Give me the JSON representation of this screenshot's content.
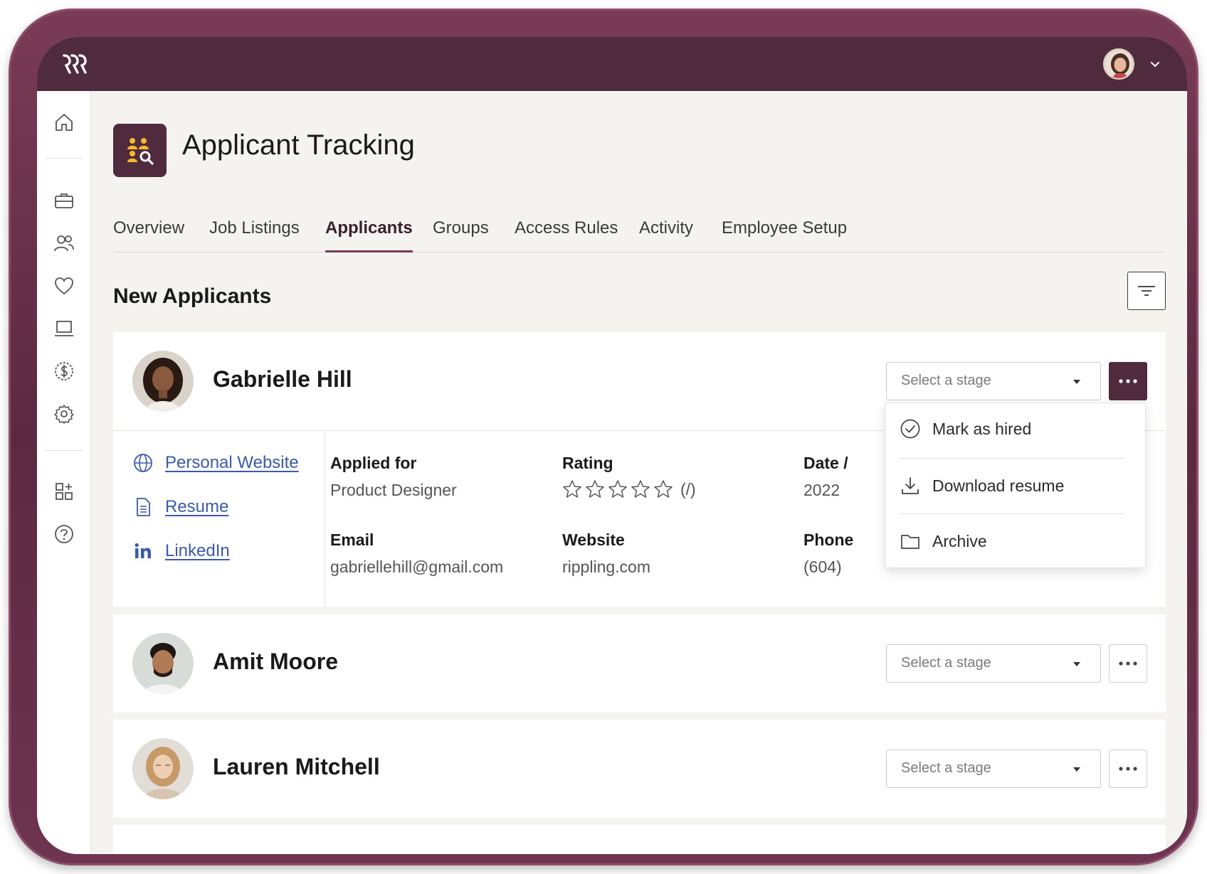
{
  "app": {
    "title": "Applicant Tracking"
  },
  "tabs": [
    {
      "label": "Overview"
    },
    {
      "label": "Job Listings"
    },
    {
      "label": "Applicants",
      "active": true
    },
    {
      "label": "Groups"
    },
    {
      "label": "Access Rules"
    },
    {
      "label": "Activity"
    },
    {
      "label": "Employee Setup"
    }
  ],
  "section": {
    "title": "New Applicants"
  },
  "sidebar": {
    "icons": [
      "home-icon",
      "briefcase-icon",
      "people-icon",
      "heart-icon",
      "laptop-icon",
      "dollar-icon",
      "settings-icon",
      "apps-icon",
      "help-icon"
    ]
  },
  "applicants": [
    {
      "name": "Gabrielle Hill",
      "stage_placeholder": "Select a stage",
      "links": {
        "website": "Personal Website",
        "resume": "Resume",
        "linkedin": "LinkedIn"
      },
      "fields": {
        "applied_for_label": "Applied for",
        "applied_for": "Product Designer",
        "rating_label": "Rating",
        "rating_text": "(/)",
        "rating_value": 0,
        "rating_max": 5,
        "date_label": "Date /",
        "date_value": "2022",
        "email_label": "Email",
        "email": "gabriellehill@gmail.com",
        "website_label": "Website",
        "website": "rippling.com",
        "phone_label": "Phone",
        "phone": "(604)"
      }
    },
    {
      "name": "Amit Moore",
      "stage_placeholder": "Select a stage"
    },
    {
      "name": "Lauren Mitchell",
      "stage_placeholder": "Select a stage"
    }
  ],
  "menu": {
    "items": [
      {
        "label": "Mark as hired",
        "icon": "check-circle-icon"
      },
      {
        "label": "Download resume",
        "icon": "download-icon"
      },
      {
        "label": "Archive",
        "icon": "folder-icon"
      }
    ]
  },
  "colors": {
    "brand": "#502a3d",
    "link": "#3b5aa8",
    "accent": "#f5b82e"
  }
}
